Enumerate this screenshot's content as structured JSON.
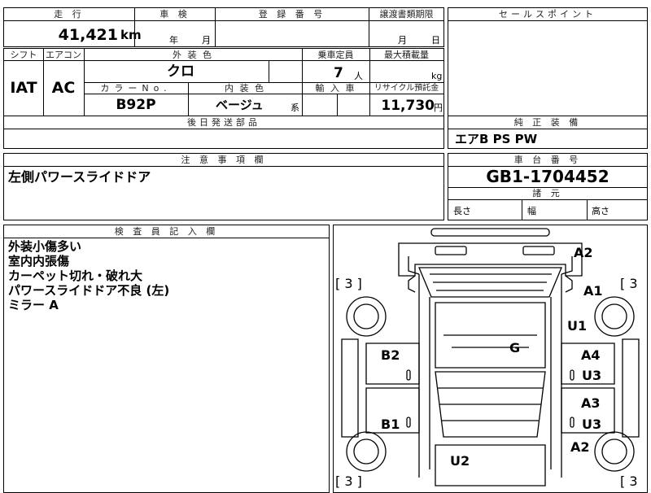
{
  "top": {
    "mileage_label": "走 行",
    "mileage_value": "41,421",
    "mileage_unit": "km",
    "inspection_label": "車 検",
    "inspection_year": "年",
    "inspection_month": "月",
    "registration_label": "登 録 番 号",
    "transfer_label": "譲渡書類期限",
    "transfer_month": "月",
    "transfer_day": "日",
    "sales_point_label": "セールスポイント"
  },
  "second": {
    "shift_label": "シフト",
    "aircon_label": "エアコン",
    "exterior_label": "外 装 色",
    "capacity_label": "乗車定員",
    "maxload_label": "最大積載量",
    "shift_value": "IAT",
    "aircon_value": "AC",
    "exterior_value": "クロ",
    "capacity_value": "7",
    "capacity_unit": "人",
    "maxload_unit": "kg",
    "color_no_label": "カラーNo.",
    "interior_label": "内 装 色",
    "import_label": "輸 入 車",
    "recycle_label": "リサイクル預託金",
    "color_no_value": "B92P",
    "interior_value": "ベージュ",
    "interior_suffix": "系",
    "recycle_value": "11,730",
    "recycle_unit": "円",
    "later_parts_label": "後日発送部品",
    "equipment_label": "純 正 装 備",
    "equipment_value": "エアB PS PW"
  },
  "notes": {
    "caution_label": "注 意 事 項 欄",
    "caution_value": "左側パワースライドドア",
    "chassis_label": "車 台 番 号",
    "chassis_value": "GB1-1704452",
    "dims_label": "諸 元",
    "length_label": "長さ",
    "width_label": "幅",
    "height_label": "高さ"
  },
  "inspector": {
    "label": "検 査 員 記 入 欄",
    "lines": [
      "外装小傷多い",
      "室内内張傷",
      "カーペット切れ・破れ大",
      "パワースライドドア不良 (左)",
      "ミラー A"
    ]
  },
  "diagram": {
    "marks": {
      "a2_top": "A2",
      "a1": "A1",
      "u1": "U1",
      "g": "G",
      "b2": "B2",
      "a4": "A4",
      "u3_upper": "U3",
      "a3": "A3",
      "b1": "B1",
      "u3_lower": "U3",
      "a2_bottom": "A2",
      "u2": "U2",
      "bracket_top_left": "[ 3 ]",
      "bracket_top_right": "[ 3",
      "bracket_bottom_left": "[ 3 ]",
      "bracket_bottom_right": "[ 3"
    }
  }
}
